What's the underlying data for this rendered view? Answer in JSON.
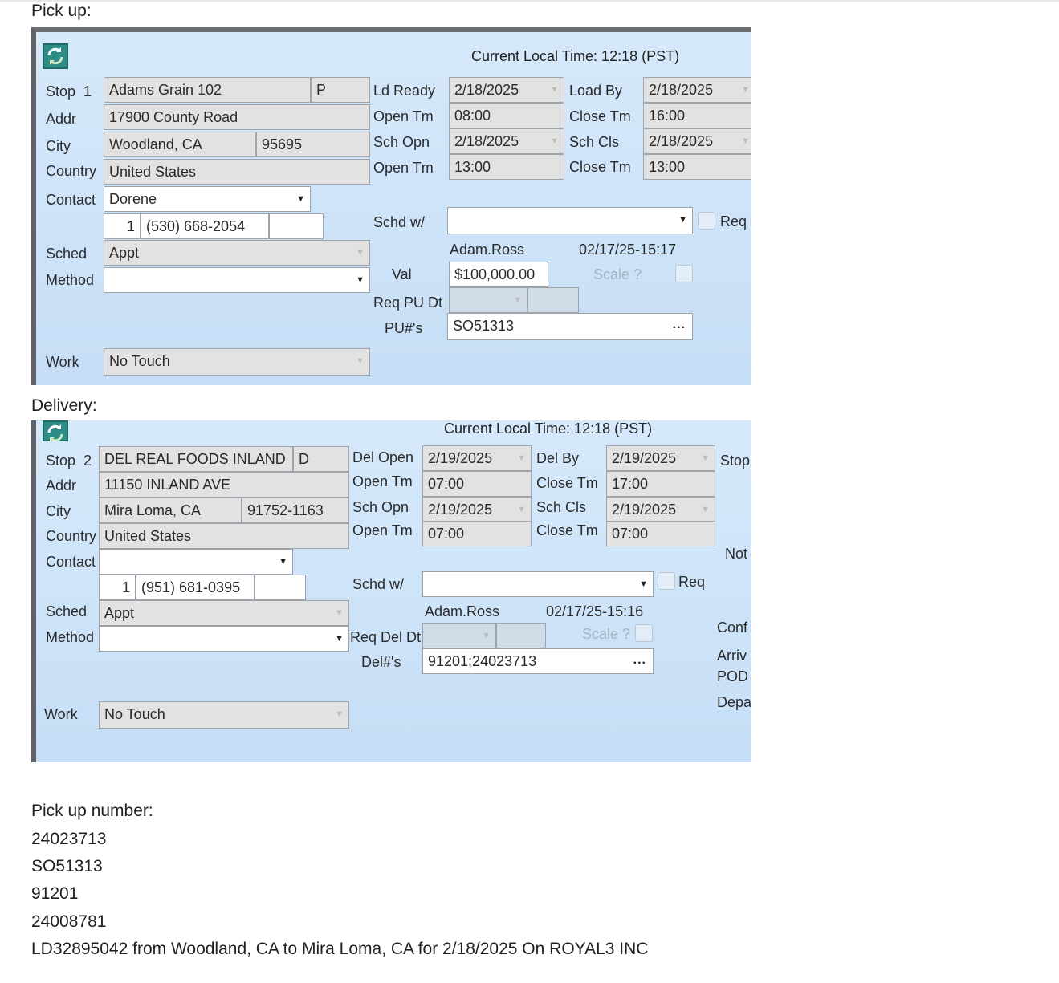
{
  "pickup_heading": "Pick up:",
  "delivery_heading": "Delivery:",
  "pickup_panel": {
    "current_time": "Current Local Time: 12:18 (PST)",
    "stop_label": "Stop",
    "stop_num": "1",
    "stop_name": "Adams Grain 102",
    "stop_type": "P",
    "addr_label": "Addr",
    "addr": "17900 County Road",
    "city_label": "City",
    "city": "Woodland, CA",
    "zip": "95695",
    "country_label": "Country",
    "country": "United States",
    "contact_label": "Contact",
    "contact": "Dorene",
    "phone_country": "1",
    "phone": "(530) 668-2054",
    "sched_label": "Sched",
    "sched": "Appt",
    "method_label": "Method",
    "method": "",
    "work_label": "Work",
    "work": "No Touch",
    "ld_ready_label": "Ld Ready",
    "ld_ready": "2/18/2025",
    "open_tm_label": "Open Tm",
    "open_tm": "08:00",
    "sch_opn_label": "Sch Opn",
    "sch_opn": "2/18/2025",
    "open_tm2_label": "Open Tm",
    "open_tm2": "13:00",
    "load_by_label": "Load By",
    "load_by": "2/18/2025",
    "close_tm_label": "Close Tm",
    "close_tm": "16:00",
    "sch_cls_label": "Sch Cls",
    "sch_cls": "2/18/2025",
    "close_tm2_label": "Close Tm",
    "close_tm2": "13:00",
    "schd_w_label": "Schd w/",
    "req_label": "Req",
    "user": "Adam.Ross",
    "timestamp": "02/17/25-15:17",
    "val_label": "Val",
    "val": "$100,000.00",
    "scale_label": "Scale ?",
    "req_dt_label": "Req PU Dt",
    "nums_label": "PU#'s",
    "nums": "SO51313",
    "dots": "..."
  },
  "delivery_panel": {
    "current_time": "Current Local Time: 12:18 (PST)",
    "stop_label": "Stop",
    "stop_num": "2",
    "stop_name": "DEL REAL FOODS INLAND",
    "stop_type": "D",
    "addr_label": "Addr",
    "addr": "11150 INLAND AVE",
    "city_label": "City",
    "city": "Mira Loma, CA",
    "zip": "91752-1163",
    "country_label": "Country",
    "country": "United States",
    "contact_label": "Contact",
    "contact": "",
    "phone_country": "1",
    "phone": "(951) 681-0395",
    "sched_label": "Sched",
    "sched": "Appt",
    "method_label": "Method",
    "method": "",
    "work_label": "Work",
    "work": "No Touch",
    "del_open_label": "Del Open",
    "del_open": "2/19/2025",
    "open_tm_label": "Open Tm",
    "open_tm": "07:00",
    "sch_opn_label": "Sch Opn",
    "sch_opn": "2/19/2025",
    "open_tm2_label": "Open Tm",
    "open_tm2": "07:00",
    "del_by_label": "Del By",
    "del_by": "2/19/2025",
    "close_tm_label": "Close Tm",
    "close_tm": "17:00",
    "sch_cls_label": "Sch Cls",
    "sch_cls": "2/19/2025",
    "close_tm2_label": "Close Tm",
    "close_tm2": "07:00",
    "schd_w_label": "Schd w/",
    "req_label": "Req",
    "user": "Adam.Ross",
    "timestamp": "02/17/25-15:16",
    "scale_label": "Scale ?",
    "req_dt_label": "Req Del Dt",
    "nums_label": "Del#'s",
    "nums": "91201;24023713",
    "dots": "...",
    "side_stop": "Stop",
    "side_not": "Not",
    "side_conf": "Conf",
    "side_arriv": "Arriv",
    "side_pod": "POD",
    "side_depa": "Depa"
  },
  "notes": {
    "heading": "Pick up number:",
    "lines": [
      "24023713",
      "SO51313",
      "91201",
      "24008781"
    ],
    "summary": "LD32895042 from Woodland, CA to Mira Loma, CA for 2/18/2025 On ROYAL3 INC"
  }
}
